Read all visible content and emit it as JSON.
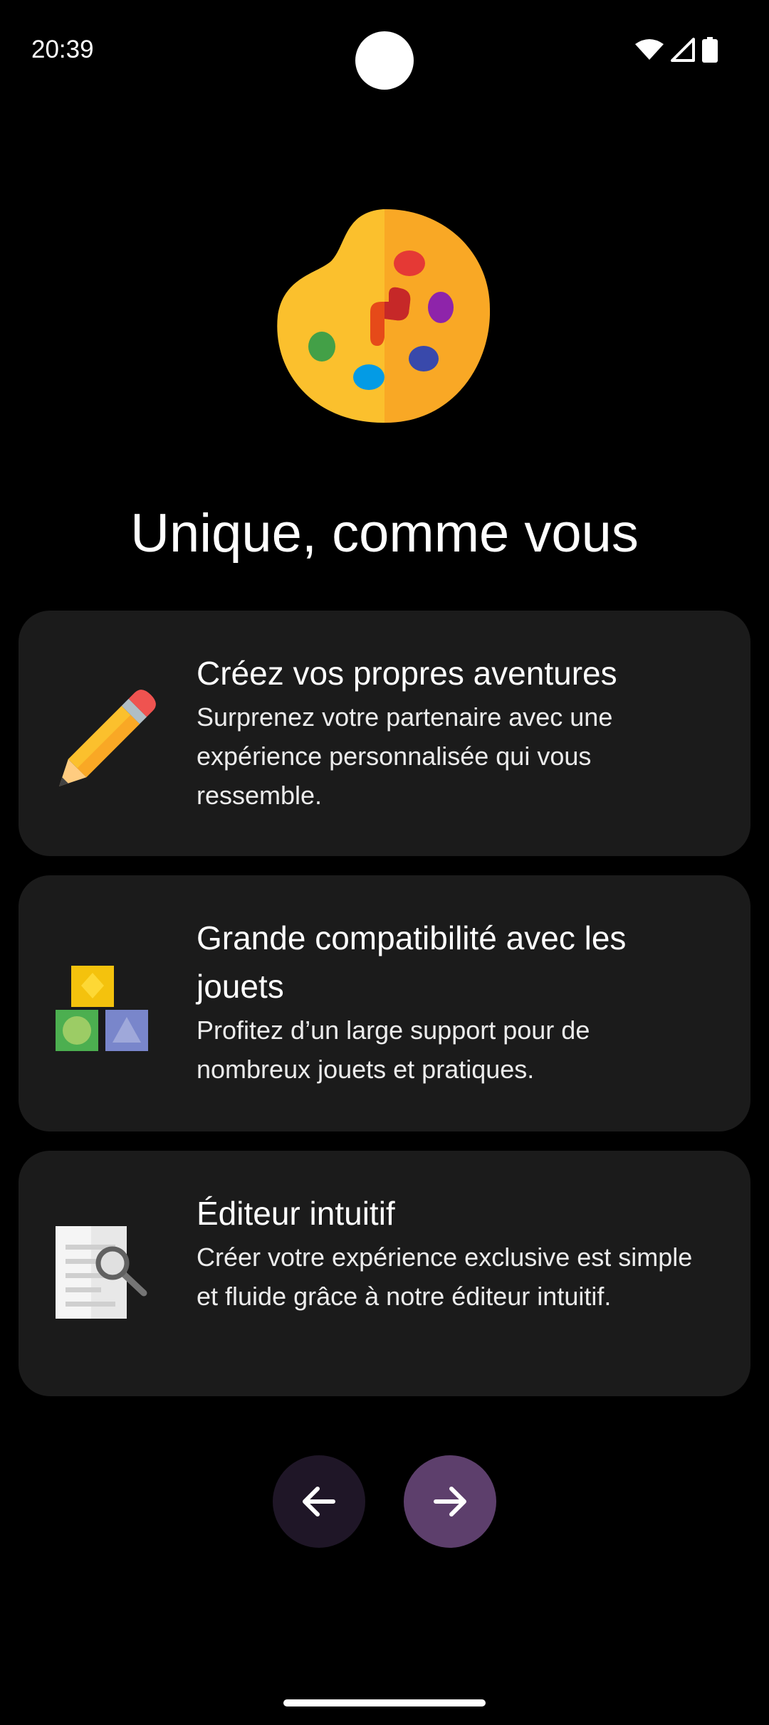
{
  "status_bar": {
    "time": "20:39",
    "icons": [
      "wifi-icon",
      "signal-icon",
      "battery-icon"
    ]
  },
  "hero": {
    "icon": "palette-icon",
    "title": "Unique, comme vous"
  },
  "features": [
    {
      "icon": "pencil-icon",
      "title": "Créez vos propres aventures",
      "description": "Surprenez votre partenaire avec une expérience personnalisée qui vous ressemble."
    },
    {
      "icon": "toy-blocks-icon",
      "title": "Grande compatibilité avec les jouets",
      "description": "Profitez d’un large support pour de nombreux jouets et pratiques."
    },
    {
      "icon": "document-search-icon",
      "title": "Éditeur intuitif",
      "description": "Créer votre expérience exclusive est simple et fluide grâce à notre éditeur intuitif."
    }
  ],
  "navigation": {
    "back_icon": "arrow-left-icon",
    "next_icon": "arrow-right-icon"
  },
  "colors": {
    "background": "#000000",
    "card": "#1b1b1b",
    "back_button": "#1f1627",
    "next_button": "#5d3f6c"
  }
}
